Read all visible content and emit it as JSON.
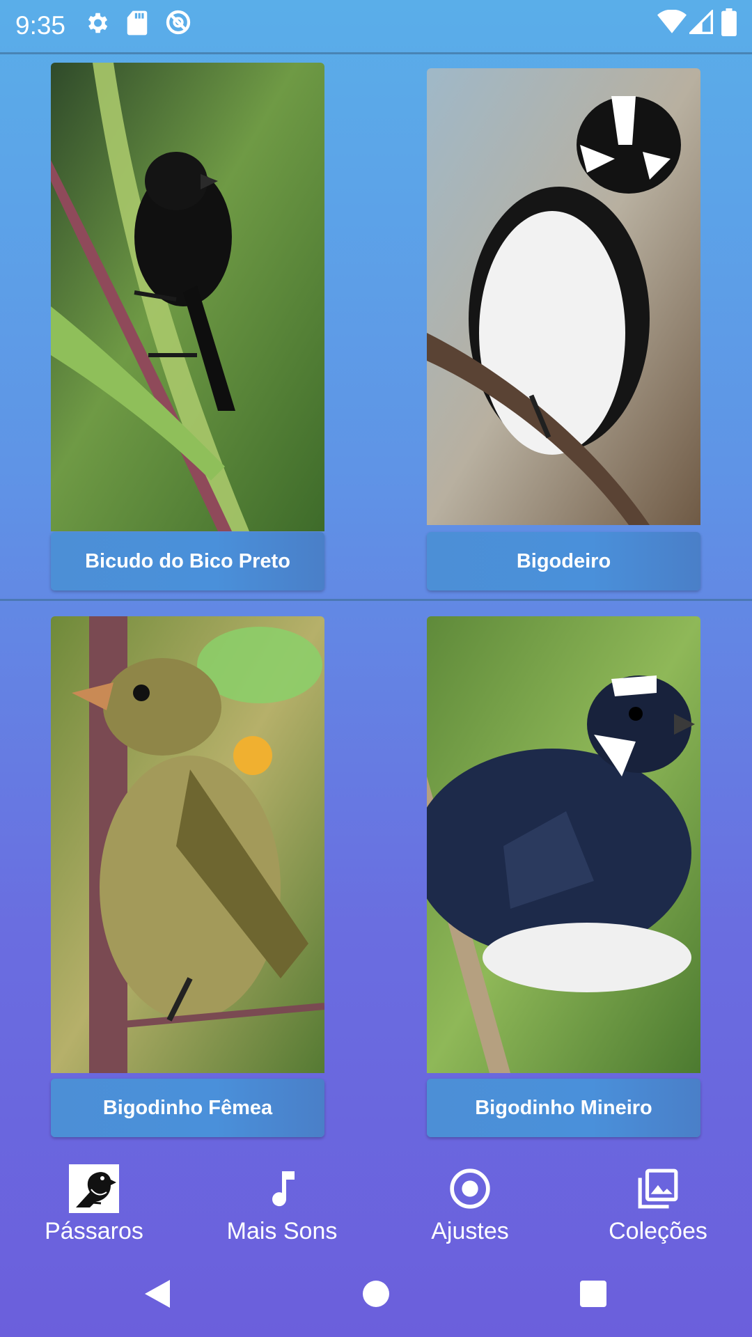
{
  "status_bar": {
    "time": "9:35",
    "icons": [
      "settings-icon",
      "sd-card-icon",
      "no-disturb-icon",
      "wifi-icon",
      "signal-icon",
      "battery-icon"
    ]
  },
  "birds": [
    {
      "name": "Bicudo do Bico Preto",
      "photo": "black-bird-on-stem"
    },
    {
      "name": "Bigodeiro",
      "photo": "black-white-bird-on-branch"
    },
    {
      "name": "Bigodinho Fêmea",
      "photo": "olive-brown-bird-on-stem"
    },
    {
      "name": "Bigodinho Mineiro",
      "photo": "dark-blue-white-bird-on-stem"
    }
  ],
  "bottom_nav": {
    "items": [
      {
        "label": "Pássaros",
        "icon": "bird-icon",
        "active": true
      },
      {
        "label": "Mais Sons",
        "icon": "music-note-icon",
        "active": false
      },
      {
        "label": "Ajustes",
        "icon": "radio-button-icon",
        "active": false
      },
      {
        "label": "Coleções",
        "icon": "photo-library-icon",
        "active": false
      }
    ]
  },
  "system_nav": [
    "back-icon",
    "home-icon",
    "recents-icon"
  ],
  "colors": {
    "background_top": "#5aaee9",
    "background_bottom": "#6b5fdc",
    "button": "#4a90da",
    "text": "#ffffff"
  }
}
